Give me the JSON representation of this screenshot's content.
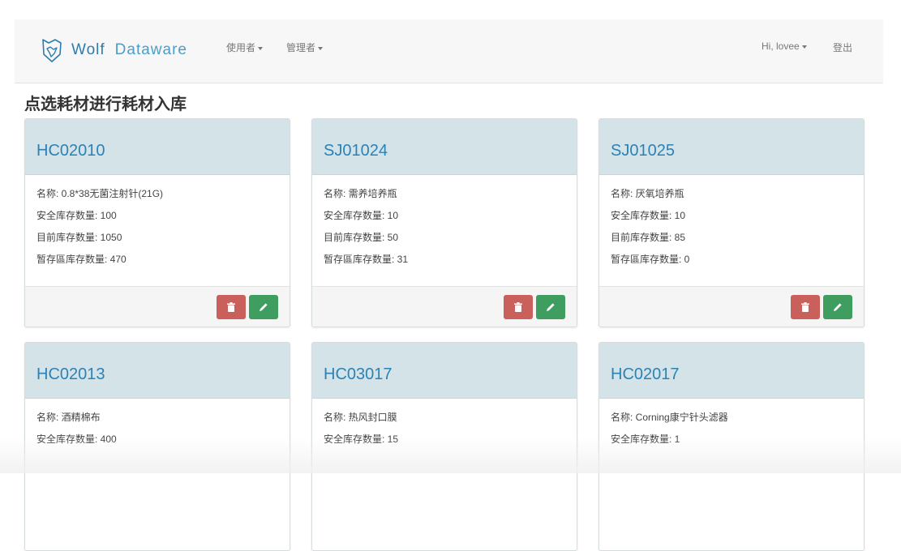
{
  "brand": {
    "part1": "Wolf",
    "part2": "Dataware"
  },
  "nav": {
    "users": "使用者",
    "admin": "管理者",
    "greeting": "Hi, lovee",
    "logout": "登出"
  },
  "page": {
    "title": "点选耗材进行耗材入库"
  },
  "labels": {
    "name": "名称: ",
    "safety": "安全库存数量: ",
    "current": "目前库存数量: ",
    "temp": "暂存區库存数量: "
  },
  "cards": [
    {
      "code": "HC02010",
      "name": "0.8*38无菌注射针(21G)",
      "safety": "100",
      "current": "1050",
      "temp": "470"
    },
    {
      "code": "SJ01024",
      "name": "需养培养瓶",
      "safety": "10",
      "current": "50",
      "temp": "31"
    },
    {
      "code": "SJ01025",
      "name": "厌氧培养瓶",
      "safety": "10",
      "current": "85",
      "temp": "0"
    },
    {
      "code": "HC02013",
      "name": "酒精棉布",
      "safety": "400"
    },
    {
      "code": "HC03017",
      "name": "热风封口膜",
      "safety": "15"
    },
    {
      "code": "HC02017",
      "name": "Corning康宁针头滤器",
      "safety": "1"
    }
  ],
  "colors": {
    "card_header": "#d3e3e8",
    "code_text": "#2a82b8",
    "delete_button": "#c9605c",
    "edit_button": "#3f9e5f"
  },
  "icons": {
    "delete": "trash-icon",
    "edit": "pencil-icon"
  }
}
